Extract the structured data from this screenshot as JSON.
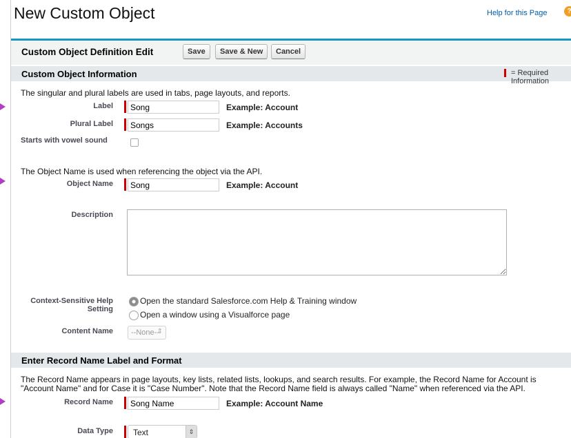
{
  "page": {
    "title": "New Custom Object",
    "help_link": "Help for this Page",
    "help_icon": "help-icon"
  },
  "header": {
    "title": "Custom Object Definition Edit",
    "buttons": {
      "save": "Save",
      "save_new": "Save & New",
      "cancel": "Cancel"
    }
  },
  "section_info": {
    "title": "Custom Object Information",
    "required_legend": "= Required Information",
    "intro_labels": "The singular and plural labels are used in tabs, page layouts, and reports.",
    "label": {
      "label": "Label",
      "value": "Song",
      "example": "Example:  Account"
    },
    "plural_label": {
      "label": "Plural Label",
      "value": "Songs",
      "example": "Example:  Accounts"
    },
    "vowel": {
      "label": "Starts with vowel sound",
      "checked": false
    },
    "intro_object_name": "The Object Name is used when referencing the object via the API.",
    "object_name": {
      "label": "Object Name",
      "value": "Song",
      "example": "Example:  Account"
    },
    "description": {
      "label": "Description",
      "value": ""
    },
    "help_setting": {
      "label_line1": "Context-Sensitive Help",
      "label_line2": "Setting",
      "option1": "Open the standard Salesforce.com Help & Training window",
      "option2": "Open a window using a Visualforce page",
      "selected": "option1"
    },
    "content_name": {
      "label": "Content Name",
      "value": "--None--"
    }
  },
  "section_record": {
    "title": "Enter Record Name Label and Format",
    "intro_line1": "The Record Name appears in page layouts, key lists, related lists, lookups, and search results. For example, the Record Name for Account is",
    "intro_line2": "\"Account Name\" and for Case it is \"Case Number\". Note that the Record Name field is always called \"Name\" when referenced via the API.",
    "record_name": {
      "label": "Record Name",
      "value": "Song Name",
      "example": "Example:  Account Name"
    },
    "data_type": {
      "label": "Data Type",
      "value": "Text"
    }
  },
  "colors": {
    "accent": "#1797c0",
    "required": "#cc0000",
    "link": "#015ba7",
    "arrow": "#b03fc4"
  }
}
